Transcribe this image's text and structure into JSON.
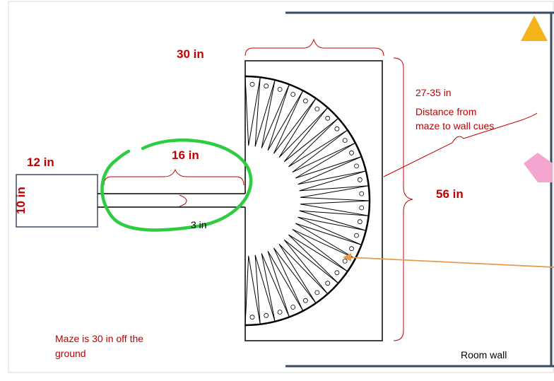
{
  "labels": {
    "start_box_width": "12 in",
    "start_box_height": "10 in",
    "corridor_length": "16 in",
    "corridor_width": "3 in",
    "maze_width": "30 in",
    "maze_height": "56 in",
    "cue_distance": "27-35 in",
    "cue_distance_note_line1": "Distance from",
    "cue_distance_note_line2": "maze to wall cues",
    "ground_note_line1": "Maze is 30 in off the",
    "ground_note_line2": "ground",
    "room_wall": "Room wall"
  },
  "colors": {
    "dimension_red": "#c00000",
    "wall_navy": "#3b4a63",
    "cue_triangle": "#f5b31c",
    "cue_pentagon": "#f4a6d0",
    "highlight_green": "#2ecc40",
    "pointer_orange": "#e59b4e"
  },
  "maze": {
    "arm_count": 26
  }
}
